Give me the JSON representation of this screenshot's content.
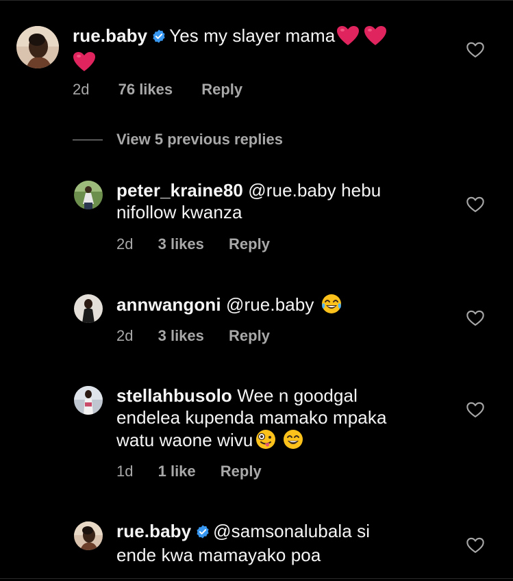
{
  "colors": {
    "background": "#000000",
    "text": "#f5f5f5",
    "secondary_text": "#a8a8a8",
    "verified_badge": "#3897f0",
    "heart_emoji": "#e0245e"
  },
  "comments": [
    {
      "username": "rue.baby",
      "verified": true,
      "text": "Yes my slayer mama",
      "emojis": [
        "red-heart",
        "red-heart",
        "red-heart"
      ],
      "time": "2d",
      "likes": "76 likes",
      "reply": "Reply"
    },
    {
      "username": "peter_kraine80",
      "verified": false,
      "text_line1": "@rue.baby hebu",
      "text_line2": "nifollow kwanza",
      "time": "2d",
      "likes": "3 likes",
      "reply": "Reply"
    },
    {
      "username": "annwangoni",
      "verified": false,
      "text": "@rue.baby",
      "emojis": [
        "face-with-tears-of-joy"
      ],
      "time": "2d",
      "likes": "3 likes",
      "reply": "Reply"
    },
    {
      "username": "stellahbusolo",
      "verified": false,
      "text_line1": "Wee n goodgal",
      "text_line2": "endelea kupenda mamako mpaka",
      "text_line3": "watu waone wivu",
      "emojis": [
        "zany-face",
        "grinning-face-with-smiling-eyes"
      ],
      "time": "1d",
      "likes": "1 like",
      "reply": "Reply"
    },
    {
      "username": "rue.baby",
      "verified": true,
      "text_line1": "@samsonalubala si",
      "text_line2": "ende kwa mamayako poa"
    }
  ],
  "view_replies": {
    "label": "View 5 previous replies"
  },
  "icons": {
    "like": "heart-outline-icon",
    "verified": "verified-badge-icon"
  }
}
